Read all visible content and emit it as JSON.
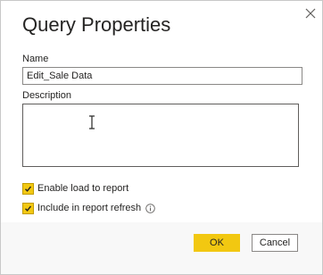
{
  "dialog": {
    "title": "Query Properties",
    "close_icon": "close-icon"
  },
  "name_field": {
    "label": "Name",
    "value": "Edit_Sale Data"
  },
  "description_field": {
    "label": "Description",
    "value": ""
  },
  "options": {
    "enable_load": {
      "label": "Enable load to report",
      "checked": true
    },
    "include_refresh": {
      "label": "Include in report refresh",
      "checked": true,
      "info_icon": "info-icon"
    }
  },
  "buttons": {
    "ok": "OK",
    "cancel": "Cancel"
  },
  "colors": {
    "accent": "#f2c811",
    "footer_bg": "#f8f8f8",
    "border": "#8a8886"
  }
}
